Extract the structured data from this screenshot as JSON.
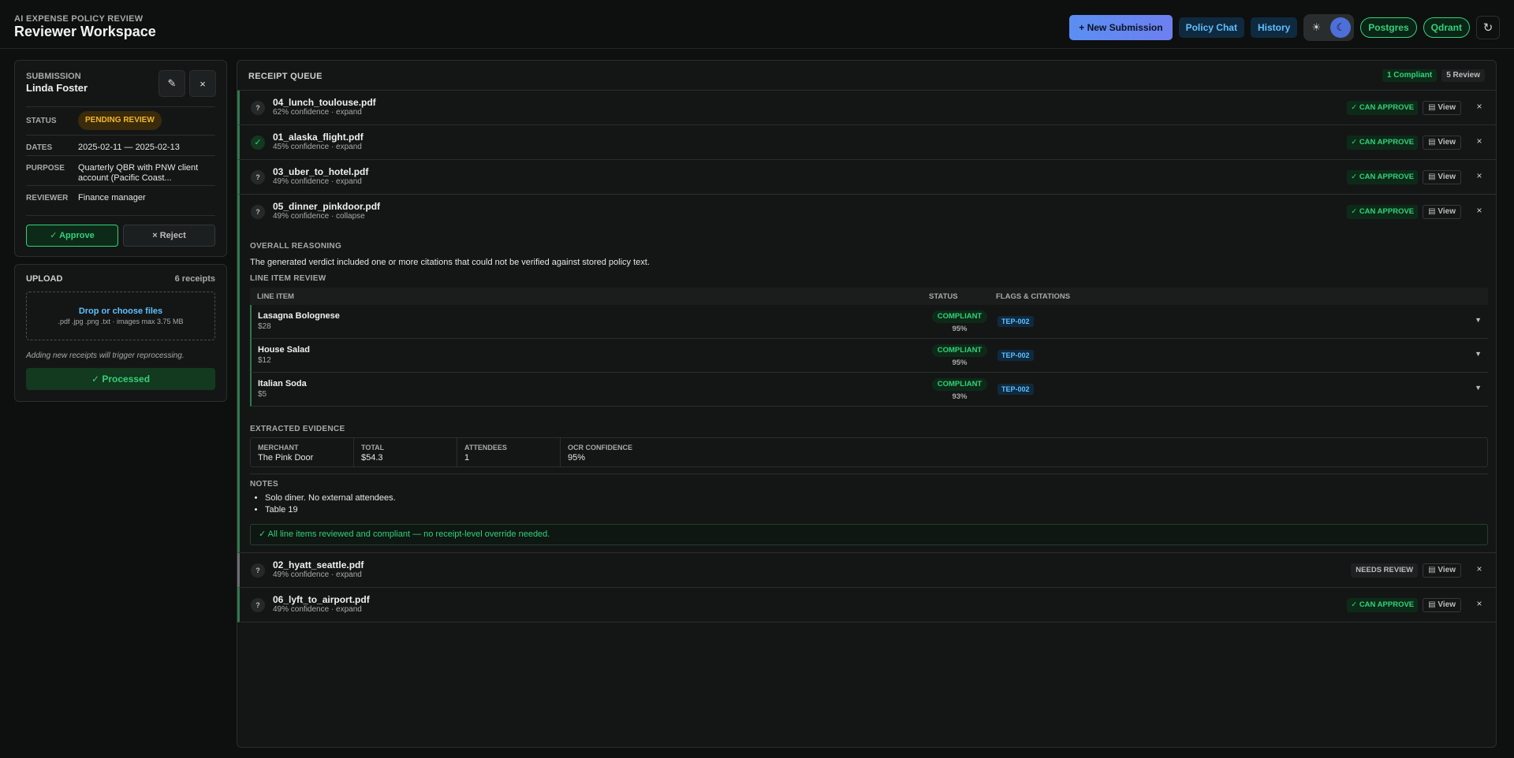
{
  "header": {
    "kicker": "AI EXPENSE POLICY REVIEW",
    "title": "Reviewer Workspace",
    "new_submission": "+ New Submission",
    "policy_chat": "Policy Chat",
    "history": "History",
    "theme_light_icon": "☀",
    "theme_dark_icon": "☾",
    "postgres": "Postgres",
    "qdrant": "Qdrant",
    "refresh_icon": "↻"
  },
  "submission": {
    "label": "SUBMISSION",
    "name": "Linda Foster",
    "edit_icon": "✎",
    "close_icon": "×",
    "status_key": "STATUS",
    "status_value": "PENDING REVIEW",
    "dates_key": "DATES",
    "dates_value": "2025-02-11 — 2025-02-13",
    "purpose_key": "PURPOSE",
    "purpose_value": "Quarterly QBR with PNW client account (Pacific Coast...",
    "reviewer_key": "REVIEWER",
    "reviewer_value": "Finance manager",
    "approve": "✓ Approve",
    "reject": "× Reject"
  },
  "upload": {
    "label": "UPLOAD",
    "count": "6 receipts",
    "drop_main": "Drop or choose files",
    "drop_sub": ".pdf .jpg .png .txt · images max 3.75 MB",
    "note": "Adding new receipts will trigger reprocessing.",
    "processed": "✓ Processed"
  },
  "queue": {
    "title": "RECEIPT QUEUE",
    "badge_compliant": "1 Compliant",
    "badge_review": "5 Review",
    "view_label": "View",
    "view_icon": "▤",
    "close_icon": "×",
    "receipts": [
      {
        "mark": "?",
        "name": "04_lunch_toulouse.pdf",
        "sub": "62% confidence · expand",
        "status": "✓ CAN APPROVE"
      },
      {
        "mark": "✓",
        "name": "01_alaska_flight.pdf",
        "sub": "45% confidence · expand",
        "status": "✓ CAN APPROVE"
      },
      {
        "mark": "?",
        "name": "03_uber_to_hotel.pdf",
        "sub": "49% confidence · expand",
        "status": "✓ CAN APPROVE"
      },
      {
        "mark": "?",
        "name": "05_dinner_pinkdoor.pdf",
        "sub": "49% confidence · collapse",
        "status": "✓ CAN APPROVE"
      },
      {
        "mark": "?",
        "name": "02_hyatt_seattle.pdf",
        "sub": "49% confidence · expand",
        "status": "NEEDS REVIEW"
      },
      {
        "mark": "?",
        "name": "06_lyft_to_airport.pdf",
        "sub": "49% confidence · expand",
        "status": "✓ CAN APPROVE"
      }
    ]
  },
  "detail": {
    "reasoning_label": "OVERALL REASONING",
    "reasoning_text": "The generated verdict included one or more citations that could not be verified against stored policy text.",
    "line_items_label": "LINE ITEM REVIEW",
    "col_item": "LINE ITEM",
    "col_status": "STATUS",
    "col_flags": "FLAGS & CITATIONS",
    "chevron": "▼",
    "line_items": [
      {
        "name": "Lasagna Bolognese",
        "amount": "$28",
        "status": "COMPLIANT",
        "confidence": "95%",
        "flag": "TEP-002"
      },
      {
        "name": "House Salad",
        "amount": "$12",
        "status": "COMPLIANT",
        "confidence": "95%",
        "flag": "TEP-002"
      },
      {
        "name": "Italian Soda",
        "amount": "$5",
        "status": "COMPLIANT",
        "confidence": "93%",
        "flag": "TEP-002"
      }
    ],
    "evidence_label": "EXTRACTED EVIDENCE",
    "evidence": [
      {
        "key": "MERCHANT",
        "value": "The Pink Door"
      },
      {
        "key": "TOTAL",
        "value": "$54.3"
      },
      {
        "key": "ATTENDEES",
        "value": "1"
      },
      {
        "key": "OCR CONFIDENCE",
        "value": "95%"
      }
    ],
    "notes_label": "NOTES",
    "notes": [
      "Solo diner. No external attendees.",
      "Table 19"
    ],
    "ok_banner": "✓ All line items reviewed and compliant — no receipt-level override needed."
  }
}
